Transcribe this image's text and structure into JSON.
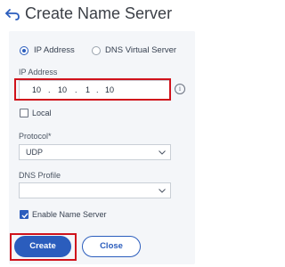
{
  "header": {
    "title": "Create Name Server",
    "back_icon": "back-arrow-icon"
  },
  "server_type": {
    "options": [
      {
        "label": "IP Address",
        "selected": true
      },
      {
        "label": "DNS Virtual Server",
        "selected": false
      }
    ]
  },
  "ip_address": {
    "label": "IP Address",
    "octets": [
      "10",
      "10",
      "1",
      "10"
    ],
    "separator": ".",
    "info_icon": "info-icon",
    "info_glyph": "i"
  },
  "local": {
    "label": "Local",
    "checked": false
  },
  "protocol": {
    "label": "Protocol*",
    "value": "UDP"
  },
  "dns_profile": {
    "label": "DNS Profile",
    "value": ""
  },
  "enable_name_server": {
    "label": "Enable Name Server",
    "checked": true
  },
  "actions": {
    "create_label": "Create",
    "close_label": "Close"
  },
  "colors": {
    "accent": "#2b5dbd",
    "highlight": "#d0121b",
    "panel_bg": "#f4f6f9"
  }
}
